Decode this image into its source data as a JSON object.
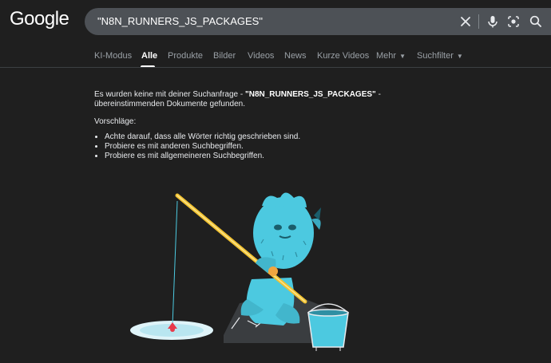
{
  "logo": "Google",
  "search": {
    "query": "\"N8N_RUNNERS_JS_PACKAGES\""
  },
  "tabs": [
    {
      "label": "KI-Modus"
    },
    {
      "label": "Alle"
    },
    {
      "label": "Produkte"
    },
    {
      "label": "Bilder"
    },
    {
      "label": "Videos"
    },
    {
      "label": "News"
    },
    {
      "label": "Kurze Videos"
    },
    {
      "label": "Mehr"
    },
    {
      "label": "Suchfilter"
    }
  ],
  "result": {
    "prefix": "Es wurden keine mit deiner Suchanfrage - ",
    "query": "\"N8N_RUNNERS_JS_PACKAGES\"",
    "suffix": " - übereinstimmenden Dokumente gefunden.",
    "suggestions_heading": "Vorschläge:",
    "suggestions": [
      "Achte darauf, dass alle Wörter richtig geschrieben sind.",
      "Probiere es mit anderen Suchbegriffen.",
      "Probiere es mit allgemeineren Suchbegriffen."
    ]
  },
  "icons": {
    "clear": "close-icon",
    "voice": "microphone-icon",
    "lens": "camera-lens-icon",
    "search": "search-icon",
    "more_caret": "chevron-down-icon",
    "filter_caret": "chevron-down-icon"
  },
  "colors": {
    "background": "#1f1f1f",
    "searchbar": "#4d5156",
    "tab_inactive": "#9aa0a6",
    "tab_active": "#ffffff",
    "creature": "#4cc9e0",
    "rod": "#f2c230"
  }
}
